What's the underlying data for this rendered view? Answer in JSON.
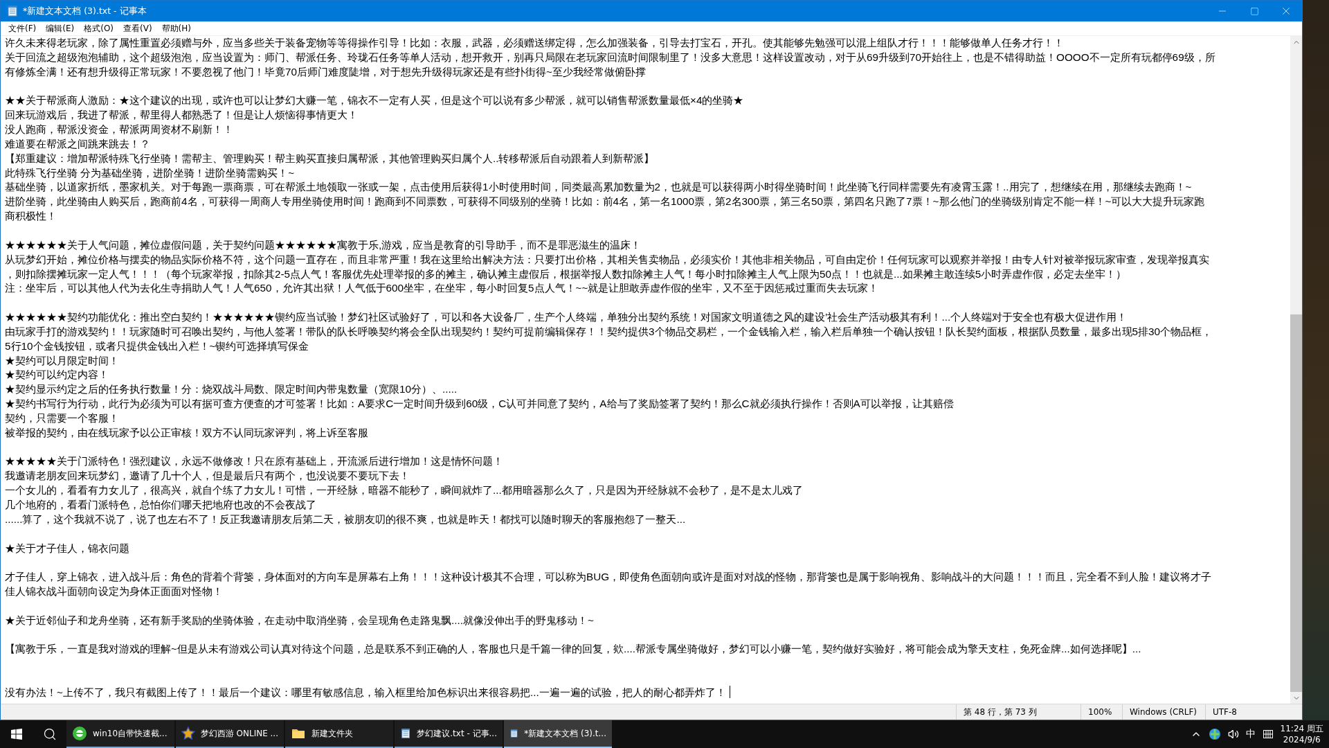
{
  "window": {
    "title": "*新建文本文档 (3).txt - 记事本"
  },
  "menu": [
    "文件(F)",
    "编辑(E)",
    "格式(O)",
    "查看(V)",
    "帮助(H)"
  ],
  "editor": {
    "lines": [
      {
        "kind": "text",
        "text": "许久未来得老玩家，除了属性重置必须赠与外，应当多些关于装备宠物等等得操作引导！比如：衣服，武器，必须赠送绑定得，怎么加强装备，引导去打宝石，开孔。使其能够先勉强可以混上组队才行！！！能够做单人任务才行！！"
      },
      {
        "kind": "text",
        "text": "关于回流之超级泡泡辅助，这个超级泡泡，应当设置为：师门、帮派任务、玲珑石任务等单人活动，想开救开，别再只局限在老玩家回流时间限制里了！没多大意思！这样设置改动，对于从69升级到70开始往上，也是不错得助益！OOOO不一定所有玩都停69级，所"
      },
      {
        "kind": "text",
        "text": "有修炼全满！还有想升级得正常玩家！不要忽视了他门！毕竟70后师门难度陡增，对于想先升级得玩家还是有些扑街得~至少我经常做俯卧撑"
      },
      {
        "kind": "blank"
      },
      {
        "kind": "text",
        "text": "★★关于帮派商人激励：★这个建议的出现，或许也可以让梦幻大赚一笔，锦衣不一定有人买，但是这个可以说有多少帮派，就可以销售帮派数量最低×4的坐骑★"
      },
      {
        "kind": "text",
        "text": "回来玩游戏后，我进了帮派，帮里得人都熟悉了！但是让人烦恼得事情更大！"
      },
      {
        "kind": "text",
        "text": "没人跑商，帮派没资金，帮派两周资材不刷新！！"
      },
      {
        "kind": "text",
        "text": "难道要在帮派之间跳来跳去！？"
      },
      {
        "kind": "text",
        "text": "【郑重建议：增加帮派特殊飞行坐骑！需帮主、管理购买！帮主购买直接归属帮派，其他管理购买归属个人..转移帮派后自动跟着人到新帮派】"
      },
      {
        "kind": "text",
        "text": "此特殊飞行坐骑 分为基础坐骑，进阶坐骑！进阶坐骑需购买！~"
      },
      {
        "kind": "text",
        "text": "基础坐骑，以道家折纸，墨家机关。对于每跑一票商票，可在帮派土地领取一张或一架，点击使用后获得1小时使用时间，同类最高累加数量为2，也就是可以获得两小时得坐骑时间！此坐骑飞行同样需要先有凌霄玉露！..用完了，想继续在用，那继续去跑商！~"
      },
      {
        "kind": "text",
        "text": "进阶坐骑，此坐骑由人购买后，跑商前4名，可获得一周商人专用坐骑使用时间！跑商到不同票数，可获得不同级别的坐骑！比如：前4名，第一名1000票，第2名300票，第三名50票，第四名只跑了7票！~那么他门的坐骑级别肯定不能一样！~可以大大提升玩家跑"
      },
      {
        "kind": "text",
        "text": "商积极性！"
      },
      {
        "kind": "blank"
      },
      {
        "kind": "text",
        "text": "★★★★★★关于人气问题，摊位虚假问题，关于契约问题★★★★★★寓教于乐,游戏，应当是教育的引导助手，而不是罪恶滋生的温床！"
      },
      {
        "kind": "text",
        "text": "从玩梦幻开始，摊位价格与摆卖的物品实际价格不符，这个问题一直存在，而且非常严重！我在这里给出解决方法：只要打出价格，其相关售卖物品，必须实价！其他非相关物品，可自由定价！任何玩家可以观察并举报！由专人针对被举报玩家审查，发现举报真实"
      },
      {
        "kind": "text",
        "text": "，则扣除摆摊玩家一定人气！！！（每个玩家举报，扣除其2-5点人气！客服优先处理举报的多的摊主，确认摊主虚假后，根据举报人数扣除摊主人气！每小时扣除摊主人气上限为50点！！也就是...如果摊主敢连续5小时弄虚作假，必定去坐牢！）"
      },
      {
        "kind": "text",
        "text": "注：坐牢后，可以其他人代为去化生寺捐助人气！人气650，允许其出狱！人气低于600坐牢，在坐牢，每小时回复5点人气！~~就是让胆敢弄虚作假的坐牢，又不至于因惩戒过重而失去玩家！"
      },
      {
        "kind": "blank"
      },
      {
        "kind": "text",
        "text": "★★★★★★契约功能优化：推出空白契约！★★★★★★锲约应当试验！梦幻社区试验好了，可以和各大设备厂，生产个人终端，单独分出契约系统！对国家文明道德之风的建设’社会生产活动极其有利！...个人终端对于安全也有极大促进作用！"
      },
      {
        "kind": "text",
        "text": "由玩家手打的游戏契约！！玩家随时可召唤出契约，与他人签署！带队的队长呼唤契约将会全队出现契约！契约可提前编辑保存！！契约提供3个物品交易栏，一个金钱输入栏，输入栏后单独一个确认按钮！队长契约面板，根据队员数量，最多出现5排30个物品框，"
      },
      {
        "kind": "text",
        "text": "5行10个金钱按钮，或者只提供金钱出入栏！~锲约可选择填写保金"
      },
      {
        "kind": "text",
        "text": "★契约可以月限定时间！"
      },
      {
        "kind": "text",
        "text": "★契约可以约定内容！"
      },
      {
        "kind": "text",
        "text": "★契约显示约定之后的任务执行数量！分：烧双战斗局数、限定时间内带鬼数量（宽限10分）、....."
      },
      {
        "kind": "text",
        "text": "★契约书写行为行动，此行为必须为可以有据可查方便查的才可签署！比如：A要求C一定时间升级到60级，C认可并同意了契约，A给与了奖励签署了契约！那么C就必须执行操作！否则A可以举报，让其赔偿"
      },
      {
        "kind": "text",
        "text": "契约，只需要一个客服！"
      },
      {
        "kind": "text",
        "text": "被举报的契约，由在线玩家予以公正审核！双方不认同玩家评判，将上诉至客服"
      },
      {
        "kind": "blank"
      },
      {
        "kind": "text",
        "text": "★★★★★关于门派特色！强烈建议，永远不做修改！只在原有基础上，开流派后进行增加！这是情怀问题！"
      },
      {
        "kind": "text",
        "text": "我邀请老朋友回来玩梦幻，邀请了几十个人，但是最后只有两个，也没说要不要玩下去！"
      },
      {
        "kind": "text",
        "text": "一个女儿的，看看有力女儿了，很高兴，就自个练了力女儿！可惜，一开经脉，暗器不能秒了，瞬间就炸了...都用暗器那么久了，只是因为开经脉就不会秒了，是不是太儿戏了"
      },
      {
        "kind": "text",
        "text": "几个地府的，看看门派特色，总怕你们哪天把地府也改的不会夜战了"
      },
      {
        "kind": "text",
        "text": "......算了，这个我就不说了，说了也左右不了！反正我邀请朋友后第二天，被朋友叨的很不爽，也就是昨天！都找可以随时聊天的客服抱怨了一整天..."
      },
      {
        "kind": "blank"
      },
      {
        "kind": "text",
        "text": "★关于才子佳人，锦衣问题"
      },
      {
        "kind": "blank"
      },
      {
        "kind": "text",
        "text": "才子佳人，穿上锦衣，进入战斗后：角色的背着个背篓，身体面对的方向车是屏幕右上角！！！这种设计极其不合理，可以称为BUG，即使角色面朝向或许是面对对战的怪物，那背篓也是属于影响视角、影响战斗的大问题！！！而且，完全看不到人脸！建议将才子"
      },
      {
        "kind": "text",
        "text": "佳人锦衣战斗面朝向设定为身体正面面对怪物！"
      },
      {
        "kind": "blank"
      },
      {
        "kind": "text",
        "text": "★关于近邻仙子和龙舟坐骑，还有新手奖励的坐骑体验，在走动中取消坐骑，会呈现角色走路鬼飘....就像没伸出手的野鬼移动！~"
      },
      {
        "kind": "blank"
      },
      {
        "kind": "text",
        "text": "【寓教于乐，一直是我对游戏的理解~但是从未有游戏公司认真对待这个问题，总是联系不到正确的人，客服也只是千篇一律的回复，欸....帮派专属坐骑做好，梦幻可以小赚一笔，契约做好实验好，将可能会成为擎天支柱，免死金牌...如何选择呢】..."
      },
      {
        "kind": "blank"
      },
      {
        "kind": "blank"
      },
      {
        "kind": "text",
        "text": "没有办法！~上传不了，我只有截图上传了！！最后一个建议：哪里有敏感信息，输入框里给加色标识出来很容易把...一遍一遍的试验，把人的耐心都弄炸了！"
      }
    ]
  },
  "status_bar": {
    "position": "第 48 行，第 73 列",
    "zoom": "100%",
    "line_ending": "Windows (CRLF)",
    "encoding": "UTF-8"
  },
  "taskbar": {
    "apps": [
      {
        "kind": "browser",
        "label": "win10自带快速截...",
        "selected": false
      },
      {
        "kind": "game",
        "label": "梦幻西游 ONLINE ...",
        "selected": false
      },
      {
        "kind": "folder",
        "label": "新建文件夹",
        "selected": false
      },
      {
        "kind": "notepad",
        "label": "梦幻建议.txt - 记事...",
        "selected": false
      },
      {
        "kind": "notepad",
        "label": "*新建文本文档 (3).t...",
        "selected": true
      }
    ],
    "tray": {
      "ime": "中",
      "time": "11:24 周五",
      "date": "2024/9/6"
    }
  }
}
